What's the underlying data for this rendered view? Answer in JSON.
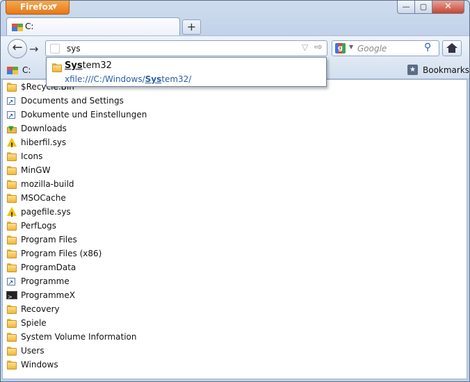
{
  "app": {
    "menu_button": "Firefox",
    "window_controls": {
      "minimize": "—",
      "maximize": "▢",
      "close": "✕"
    }
  },
  "tabs": [
    {
      "label": "C:"
    }
  ],
  "new_tab_label": "+",
  "navbar": {
    "back_glyph": "←",
    "forward_glyph": "→",
    "url_value": "sys",
    "star_glyph": "▽",
    "go_glyph": "⇨",
    "search_placeholder": "Google",
    "search_engine_letter": "g"
  },
  "bookmarks_bar": {
    "left_label": "C:",
    "right_label": "Bookmarks"
  },
  "autocomplete": {
    "title_match": "Sys",
    "title_rest": "tem32",
    "url_prefix": "xfile:///C:/Windows/",
    "url_match": "Sys",
    "url_rest": "tem32/"
  },
  "files": [
    {
      "name": "$Recycle.Bin",
      "icon": "folder"
    },
    {
      "name": "Documents and Settings",
      "icon": "shortcut"
    },
    {
      "name": "Dokumente und Einstellungen",
      "icon": "shortcut"
    },
    {
      "name": "Downloads",
      "icon": "downloads"
    },
    {
      "name": "hiberfil.sys",
      "icon": "warning"
    },
    {
      "name": "Icons",
      "icon": "folder"
    },
    {
      "name": "MinGW",
      "icon": "folder"
    },
    {
      "name": "mozilla-build",
      "icon": "folder"
    },
    {
      "name": "MSOCache",
      "icon": "folder"
    },
    {
      "name": "pagefile.sys",
      "icon": "warning"
    },
    {
      "name": "PerfLogs",
      "icon": "folder"
    },
    {
      "name": "Program Files",
      "icon": "folder"
    },
    {
      "name": "Program Files (x86)",
      "icon": "folder"
    },
    {
      "name": "ProgramData",
      "icon": "folder"
    },
    {
      "name": "Programme",
      "icon": "shortcut"
    },
    {
      "name": "ProgrammeX",
      "icon": "console"
    },
    {
      "name": "Recovery",
      "icon": "folder"
    },
    {
      "name": "Spiele",
      "icon": "folder"
    },
    {
      "name": "System Volume Information",
      "icon": "folder"
    },
    {
      "name": "Users",
      "icon": "folder"
    },
    {
      "name": "Windows",
      "icon": "folder"
    }
  ]
}
